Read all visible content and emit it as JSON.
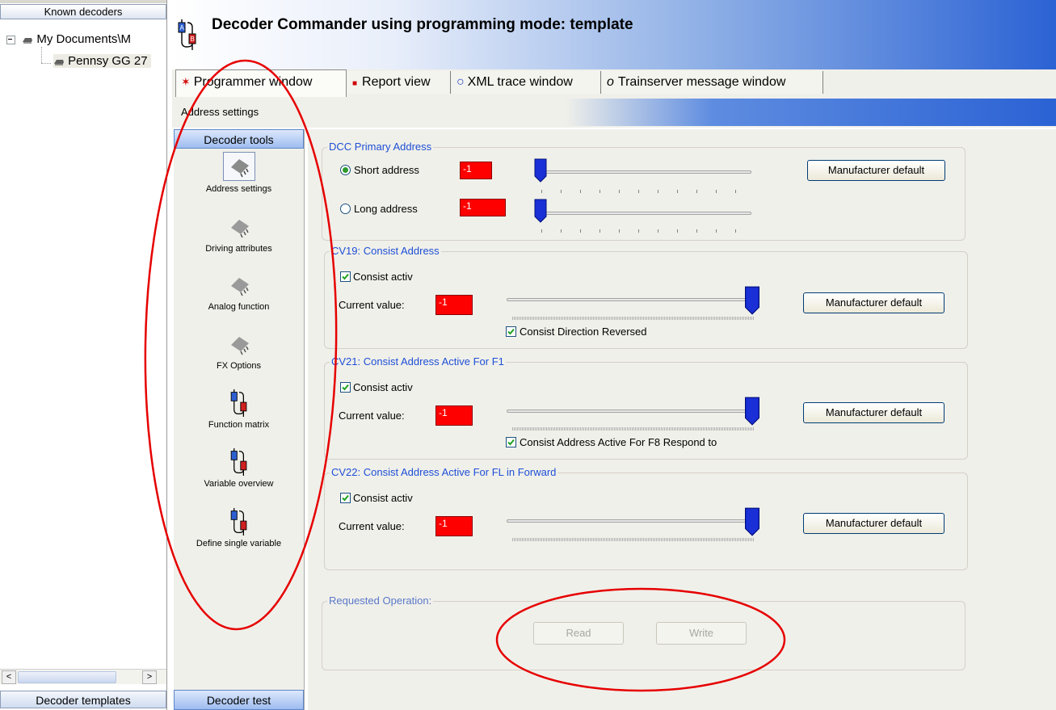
{
  "tree": {
    "header": "Known decoders",
    "items": [
      {
        "label": "My Documents\\M"
      },
      {
        "label": "Pennsy GG 27"
      }
    ],
    "footer": "Decoder templates"
  },
  "title": "Decoder Commander using programming mode: template",
  "tabs": [
    {
      "label": "Programmer window",
      "icon": "locomotive-red-icon"
    },
    {
      "label": "Report view",
      "icon": "report-icon"
    },
    {
      "label": "XML trace window",
      "icon": "xml-trace-icon"
    },
    {
      "label": "Trainserver message window",
      "icon": "message-icon"
    }
  ],
  "section": "Address settings",
  "tools": {
    "header": "Decoder tools",
    "items": [
      {
        "label": "Address settings",
        "icon": "decoder-chip-icon"
      },
      {
        "label": "Driving attributes",
        "icon": "decoder-chip-icon"
      },
      {
        "label": "Analog function",
        "icon": "decoder-chip-icon"
      },
      {
        "label": "FX Options",
        "icon": "decoder-chip-icon"
      },
      {
        "label": "Function matrix",
        "icon": "ab-switch-icon"
      },
      {
        "label": "Variable overview",
        "icon": "ab-switch-icon"
      },
      {
        "label": "Define single variable",
        "icon": "ab-switch-icon"
      }
    ],
    "footer": "Decoder test"
  },
  "dcc": {
    "title": "DCC Primary Address",
    "short_label": "Short address",
    "short_value": "-1",
    "short_selected": true,
    "long_label": "Long address",
    "long_value": "-1",
    "button": "Manufacturer default"
  },
  "cv19": {
    "title": "CV19: Consist Address",
    "activ_label": "Consist activ",
    "activ_checked": true,
    "current_label": "Current value:",
    "value": "-1",
    "extra_label": "Consist Direction Reversed",
    "extra_checked": true,
    "button": "Manufacturer default"
  },
  "cv21": {
    "title": "CV21: Consist Address Active For F1",
    "activ_label": "Consist activ",
    "activ_checked": true,
    "current_label": "Current value:",
    "value": "-1",
    "extra_label": "Consist Address Active For F8 Respond to",
    "extra_checked": true,
    "button": "Manufacturer default"
  },
  "cv22": {
    "title": "CV22: Consist Address Active For FL in Forward",
    "activ_label": "Consist activ",
    "activ_checked": true,
    "current_label": "Current value:",
    "value": "-1",
    "button": "Manufacturer default"
  },
  "operation": {
    "title": "Requested Operation:",
    "read": "Read",
    "write": "Write"
  },
  "colors": {
    "accent_blue": "#2b62d4",
    "group_title": "#1e4fd6",
    "value_red": "#ff0000",
    "annotation_red": "#e60000"
  }
}
